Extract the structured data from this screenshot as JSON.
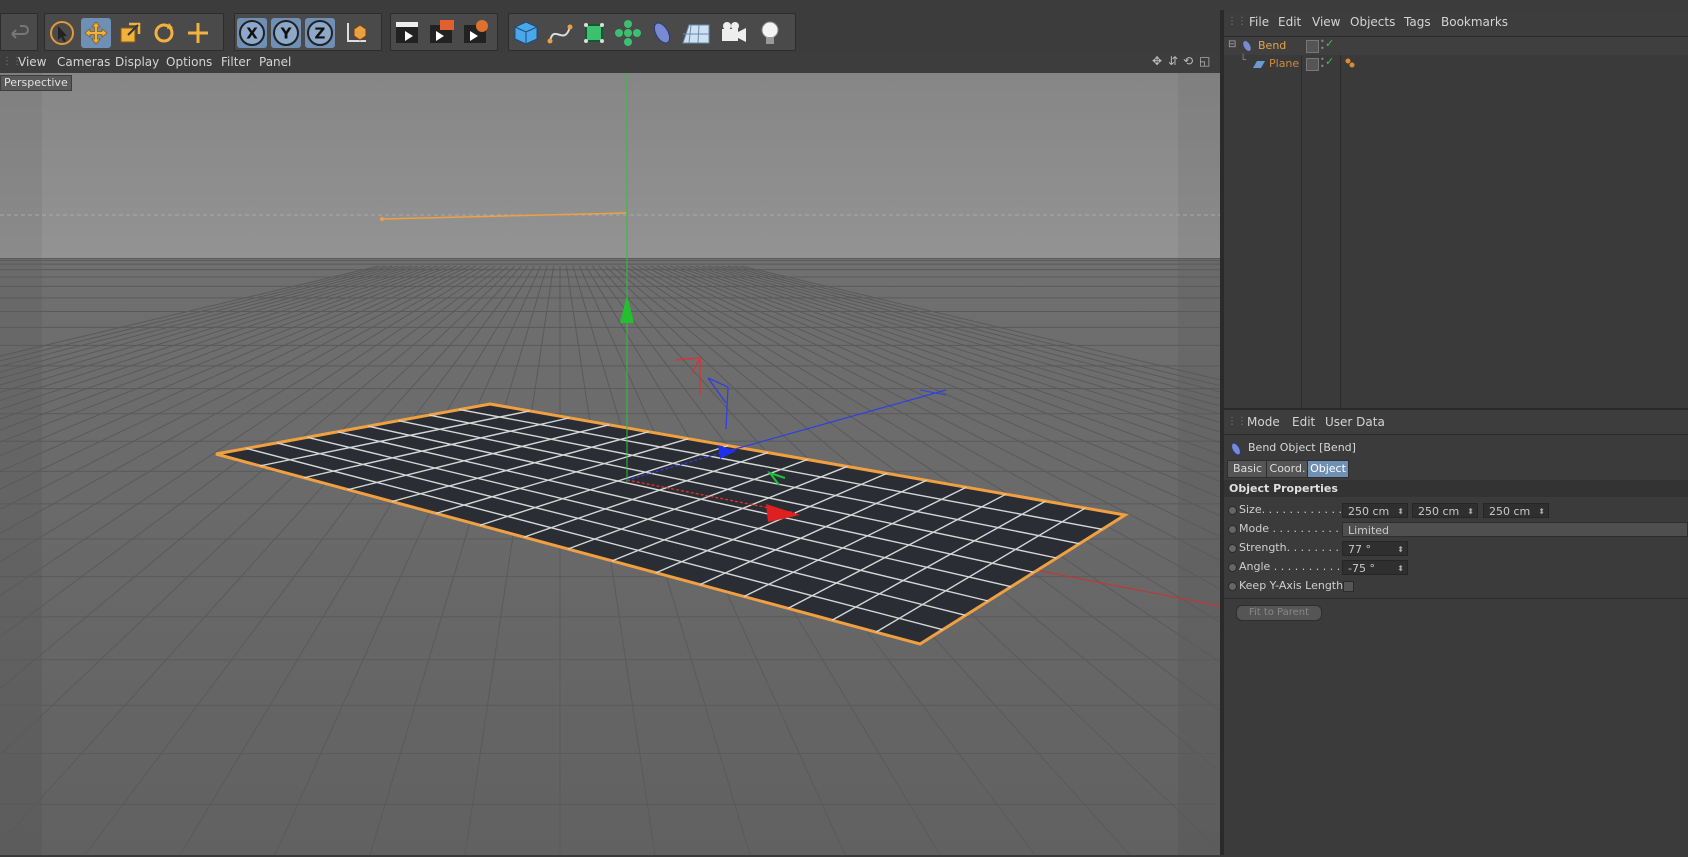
{
  "toolbar": {
    "groups": [
      {
        "tools": [
          "undo-icon"
        ]
      },
      {
        "tools": [
          "live-selection-icon",
          "move-icon",
          "scale-icon",
          "rotate-icon",
          "recent-tool-icon"
        ]
      },
      {
        "tools": [
          "x-axis-lock-icon",
          "y-axis-lock-icon",
          "z-axis-lock-icon",
          "coordinate-system-icon"
        ]
      },
      {
        "tools": [
          "render-view-icon",
          "render-picture-viewer-icon",
          "render-settings-icon"
        ]
      },
      {
        "tools": [
          "cube-icon",
          "pen-spline-icon",
          "subdivision-surface-icon",
          "cloner-icon",
          "bend-deformer-icon",
          "floor-icon",
          "camera-icon",
          "light-icon"
        ]
      }
    ],
    "axis_labels": {
      "x": "X",
      "y": "Y",
      "z": "Z"
    }
  },
  "viewport": {
    "menu": [
      "View",
      "Cameras",
      "Display",
      "Options",
      "Filter",
      "Panel"
    ],
    "camera_label": "Perspective",
    "nav_icons": [
      "move-view-icon",
      "dolly-view-icon",
      "rotate-view-icon",
      "toggle-view-icon"
    ]
  },
  "object_manager": {
    "menu": [
      "File",
      "Edit",
      "View",
      "Objects",
      "Tags",
      "Bookmarks"
    ],
    "objects": [
      {
        "name": "Bend",
        "color": "#e8a24a",
        "icon": "bend-deformer-icon"
      },
      {
        "name": "Plane",
        "color": "#d08a3a",
        "icon": "plane-icon"
      }
    ]
  },
  "attribute_manager": {
    "menu": [
      "Mode",
      "Edit",
      "User Data"
    ],
    "title": "Bend Object [Bend]",
    "tabs": [
      {
        "label": "Basic",
        "active": false
      },
      {
        "label": "Coord.",
        "active": false
      },
      {
        "label": "Object",
        "active": true
      }
    ],
    "section": "Object Properties",
    "fields": {
      "size": {
        "label": "Size. . . . . . . . . . . .",
        "values": [
          "250 cm",
          "250 cm",
          "250 cm"
        ]
      },
      "mode": {
        "label": "Mode . . . . . . . . . . .",
        "value": "Limited"
      },
      "strength": {
        "label": "Strength. . . . . . . .",
        "value": "77 °"
      },
      "angle": {
        "label": "Angle . . . . . . . . . . .",
        "value": "-75 °"
      },
      "keep_y": {
        "label": "Keep Y-Axis Length",
        "checked": false
      }
    },
    "fit_button": "Fit to Parent"
  },
  "colors": {
    "accent_active": "#6f8fb4",
    "selection_orange": "#f0a040",
    "axis_x": "#e03030",
    "axis_y": "#20c040",
    "axis_z": "#3040e0"
  }
}
